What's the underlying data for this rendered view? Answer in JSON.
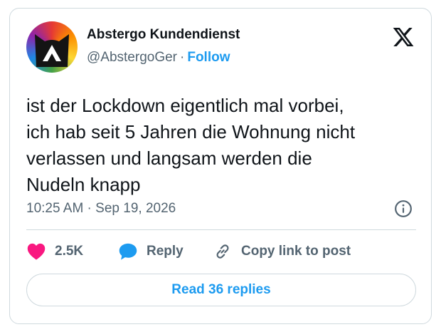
{
  "author": {
    "display_name": "Abstergo Kundendienst",
    "handle": "@AbstergoGer",
    "separator": "·",
    "follow_label": "Follow"
  },
  "tweet": {
    "lines": [
      "ist der Lockdown eigentlich mal vorbei,",
      "ich hab seit 5 Jahren die Wohnung nicht",
      "verlassen und langsam werden die",
      "Nudeln knapp"
    ],
    "timestamp": "10:25 AM · Sep 19, 2026"
  },
  "actions": {
    "like_count": "2.5K",
    "reply_label": "Reply",
    "copy_link_label": "Copy link to post"
  },
  "footer": {
    "read_replies_label": "Read 36 replies"
  },
  "icons": {
    "like": "heart-icon",
    "reply": "speech-bubble-icon",
    "copy": "link-icon",
    "info": "info-icon",
    "platform": "x-logo-icon"
  },
  "colors": {
    "accent": "#1d9bf0",
    "heart": "#f91880",
    "muted_text": "#536471",
    "border": "#cfd9de"
  }
}
